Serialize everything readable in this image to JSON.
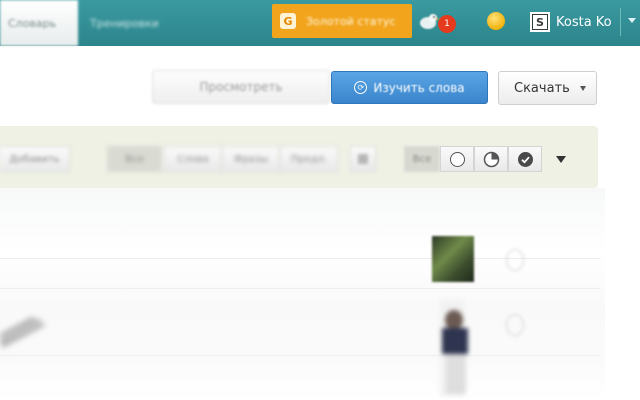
{
  "header": {
    "tabs": [
      {
        "label": "Словарь"
      },
      {
        "label": "Тренировки"
      }
    ],
    "gold_status": {
      "icon": "gold-status-icon",
      "icon_glyph": "G",
      "label": "Золотой статус"
    },
    "notifications": {
      "icon": "bird-icon",
      "count": "1"
    },
    "coin": {
      "icon": "coin-icon"
    },
    "user": {
      "avatar_glyph": "S",
      "name": "Kosta Ko"
    }
  },
  "actions": {
    "view_label": "Просмотреть",
    "learn_label": "Изучить слова",
    "download_label": "Скачать"
  },
  "toolbar": {
    "add_label": "Добавить",
    "filters": [
      {
        "label": "Все"
      },
      {
        "label": "Слова"
      },
      {
        "label": "Фразы"
      },
      {
        "label": "Предл."
      }
    ],
    "status_all_label": "Все",
    "status_icons": [
      "empty-circle-icon",
      "half-circle-icon",
      "checkmark-circle-icon"
    ]
  },
  "colors": {
    "topbar": "#2f8a91",
    "gold": "#f2a41c",
    "primary_button": "#3a85cd",
    "toolbar_bg": "#eef1e4",
    "badge": "#e63a1e"
  }
}
